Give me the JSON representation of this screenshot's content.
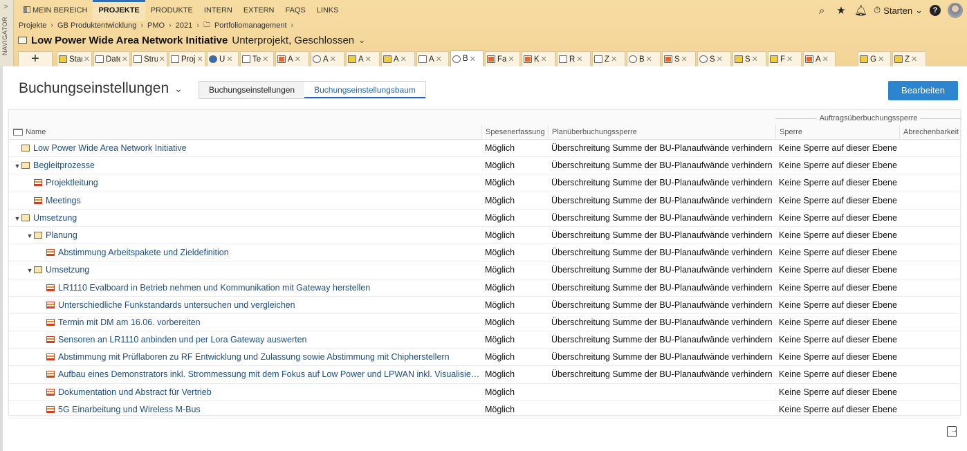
{
  "navigator": {
    "label": "NAVIGATOR",
    "chevron": ">"
  },
  "topnav": {
    "items": [
      "MEIN BEREICH",
      "PROJEKTE",
      "PRODUKTE",
      "INTERN",
      "EXTERN",
      "FAQS",
      "LINKS"
    ],
    "active": "PROJEKTE"
  },
  "topright": {
    "starten_label": "Starten",
    "help": "?"
  },
  "breadcrumb": [
    "Projekte",
    "GB Produktentwicklung",
    "PMO",
    "2021",
    "Portfoliomanagement"
  ],
  "project": {
    "name": "Low Power Wide Area Network Initiative",
    "subtitle": "Unterprojekt, Geschlossen"
  },
  "tabs": [
    {
      "label": "Star",
      "icon": "yellow"
    },
    {
      "label": "Date",
      "icon": "paperclip"
    },
    {
      "label": "Stru",
      "icon": "tree"
    },
    {
      "label": "Proj",
      "icon": "tree"
    },
    {
      "label": "Ü",
      "icon": "info"
    },
    {
      "label": "Te",
      "icon": "people"
    },
    {
      "label": "A",
      "icon": "red"
    },
    {
      "label": "A",
      "icon": "clock"
    },
    {
      "label": "A",
      "icon": "yellow"
    },
    {
      "label": "A",
      "icon": "yellow"
    },
    {
      "label": "A",
      "icon": "sigma"
    },
    {
      "label": "B",
      "icon": "clock"
    },
    {
      "label": "Fa",
      "icon": "red"
    },
    {
      "label": "K",
      "icon": "red"
    },
    {
      "label": "R",
      "icon": "sigma"
    },
    {
      "label": "Z",
      "icon": "euro"
    },
    {
      "label": "B",
      "icon": "clock"
    },
    {
      "label": "S",
      "icon": "red"
    },
    {
      "label": "S",
      "icon": "clock"
    },
    {
      "label": "S",
      "icon": "yellow"
    },
    {
      "label": "F",
      "icon": "yellow"
    },
    {
      "label": "A",
      "icon": "red"
    },
    {
      "label": "G",
      "icon": "yellow"
    },
    {
      "label": "Z",
      "icon": "yellow"
    }
  ],
  "active_tab_index": 11,
  "add_tab_label": "+",
  "page": {
    "title": "Buchungseinstellungen",
    "view_options": [
      "Buchungseinstellungen",
      "Buchungseinstellungsbaum"
    ],
    "selected_view": "Buchungseinstellungsbaum",
    "edit_button": "Bearbeiten"
  },
  "grid": {
    "group_header": "Auftragsüberbuchungssperre",
    "columns": {
      "name": "Name",
      "spesen": "Spesenerfassung",
      "plan": "Planüberbuchungssperre",
      "sperre": "Sperre",
      "abre": "Abrechenbarkeit"
    },
    "rows": [
      {
        "level": 0,
        "type": "folder",
        "expander": "",
        "name": "Low Power Wide Area Network Initiative",
        "spesen": "Möglich",
        "plan": "Überschreitung Summe der BU-Planaufwände verhindern",
        "sperre": "Keine Sperre auf dieser Ebene",
        "abre": ""
      },
      {
        "level": 0,
        "type": "folder",
        "expander": "▼",
        "name": "Begleitprozesse",
        "spesen": "Möglich",
        "plan": "Überschreitung Summe der BU-Planaufwände verhindern",
        "sperre": "Keine Sperre auf dieser Ebene",
        "abre": ""
      },
      {
        "level": 1,
        "type": "task",
        "expander": "",
        "name": "Projektleitung",
        "spesen": "Möglich",
        "plan": "Überschreitung Summe der BU-Planaufwände verhindern",
        "sperre": "Keine Sperre auf dieser Ebene",
        "abre": ""
      },
      {
        "level": 1,
        "type": "task",
        "expander": "",
        "name": "Meetings",
        "spesen": "Möglich",
        "plan": "Überschreitung Summe der BU-Planaufwände verhindern",
        "sperre": "Keine Sperre auf dieser Ebene",
        "abre": ""
      },
      {
        "level": 0,
        "type": "folder",
        "expander": "▼",
        "name": "Umsetzung",
        "spesen": "Möglich",
        "plan": "Überschreitung Summe der BU-Planaufwände verhindern",
        "sperre": "Keine Sperre auf dieser Ebene",
        "abre": ""
      },
      {
        "level": 1,
        "type": "folder",
        "expander": "▼",
        "name": "Planung",
        "spesen": "Möglich",
        "plan": "Überschreitung Summe der BU-Planaufwände verhindern",
        "sperre": "Keine Sperre auf dieser Ebene",
        "abre": ""
      },
      {
        "level": 2,
        "type": "task",
        "expander": "",
        "name": "Abstimmung Arbeitspakete und Zieldefinition",
        "spesen": "Möglich",
        "plan": "Überschreitung Summe der BU-Planaufwände verhindern",
        "sperre": "Keine Sperre auf dieser Ebene",
        "abre": ""
      },
      {
        "level": 1,
        "type": "folder",
        "expander": "▼",
        "name": "Umsetzung",
        "spesen": "Möglich",
        "plan": "Überschreitung Summe der BU-Planaufwände verhindern",
        "sperre": "Keine Sperre auf dieser Ebene",
        "abre": ""
      },
      {
        "level": 2,
        "type": "task",
        "expander": "",
        "name": "LR1110 Evalboard in Betrieb nehmen und Kommunikation mit Gateway herstellen",
        "spesen": "Möglich",
        "plan": "Überschreitung Summe der BU-Planaufwände verhindern",
        "sperre": "Keine Sperre auf dieser Ebene",
        "abre": ""
      },
      {
        "level": 2,
        "type": "task",
        "expander": "",
        "name": "Unterschiedliche Funkstandards untersuchen und vergleichen",
        "spesen": "Möglich",
        "plan": "Überschreitung Summe der BU-Planaufwände verhindern",
        "sperre": "Keine Sperre auf dieser Ebene",
        "abre": ""
      },
      {
        "level": 2,
        "type": "task",
        "expander": "",
        "name": "Termin mit DM am 16.06. vorbereiten",
        "spesen": "Möglich",
        "plan": "Überschreitung Summe der BU-Planaufwände verhindern",
        "sperre": "Keine Sperre auf dieser Ebene",
        "abre": ""
      },
      {
        "level": 2,
        "type": "task",
        "expander": "",
        "name": "Sensoren an LR1110 anbinden und per Lora Gateway auswerten",
        "spesen": "Möglich",
        "plan": "Überschreitung Summe der BU-Planaufwände verhindern",
        "sperre": "Keine Sperre auf dieser Ebene",
        "abre": ""
      },
      {
        "level": 2,
        "type": "task",
        "expander": "",
        "name": "Abstimmung mit Prüflaboren zu RF Entwicklung und Zulassung sowie Abstimmung mit Chipherstellern",
        "spesen": "Möglich",
        "plan": "Überschreitung Summe der BU-Planaufwände verhindern",
        "sperre": "Keine Sperre auf dieser Ebene",
        "abre": ""
      },
      {
        "level": 2,
        "type": "task",
        "expander": "",
        "name": "Aufbau eines Demonstrators inkl. Strommessung mit dem Fokus auf Low Power und LPWAN inkl. Visualisierung",
        "spesen": "Möglich",
        "plan": "Überschreitung Summe der BU-Planaufwände verhindern",
        "sperre": "Keine Sperre auf dieser Ebene",
        "abre": ""
      },
      {
        "level": 2,
        "type": "task",
        "expander": "",
        "name": "Dokumentation und Abstract für Vertrieb",
        "spesen": "Möglich",
        "plan": "",
        "sperre": "Keine Sperre auf dieser Ebene",
        "abre": ""
      },
      {
        "level": 2,
        "type": "task",
        "expander": "",
        "name": "5G Einarbeitung und Wireless M-Bus",
        "spesen": "Möglich",
        "plan": "",
        "sperre": "Keine Sperre auf dieser Ebene",
        "abre": ""
      }
    ]
  }
}
